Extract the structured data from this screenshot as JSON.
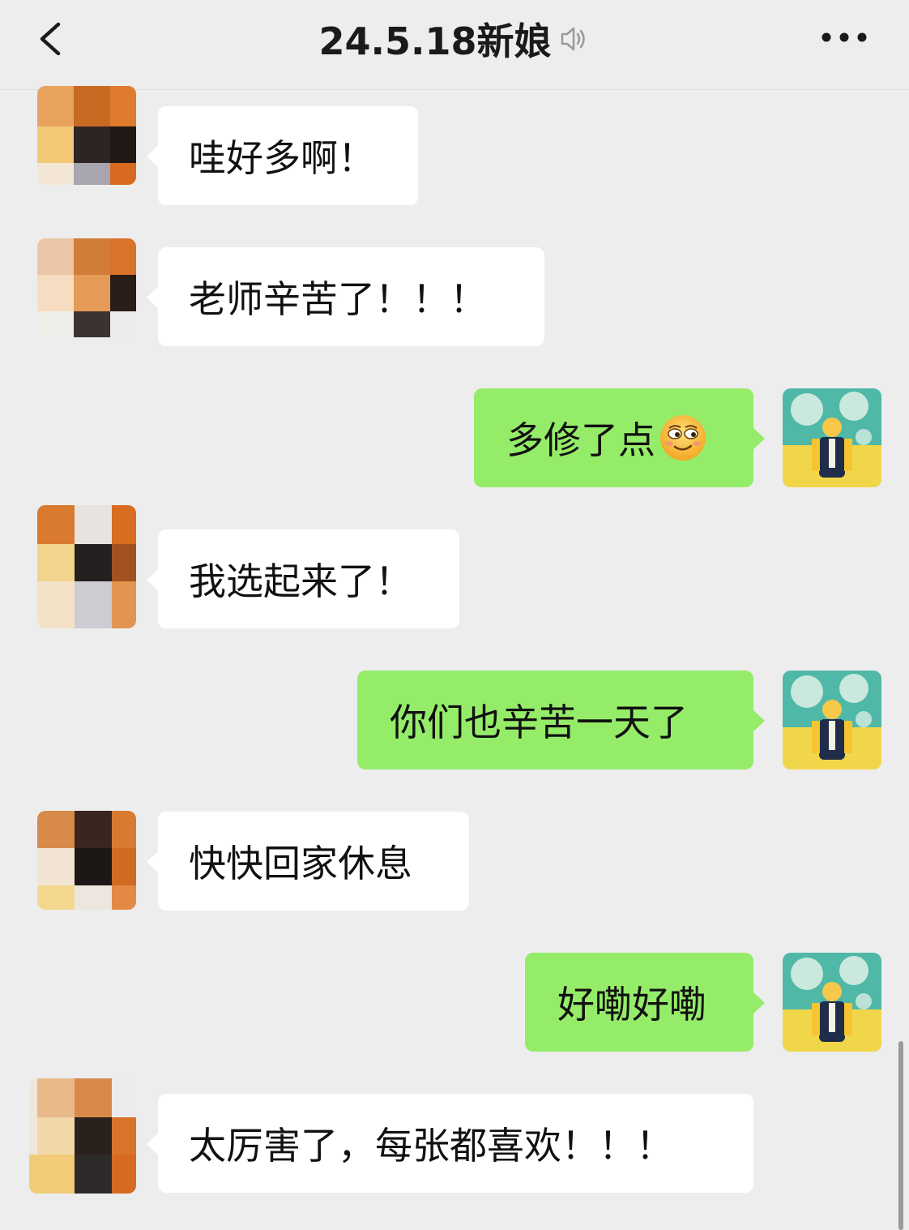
{
  "header": {
    "title": "24.5.18新娘",
    "back_icon": "chevron-left-icon",
    "mute_icon": "muted-speaker-icon",
    "more_icon": "more-dots-icon"
  },
  "colors": {
    "background": "#ededed",
    "incoming_bubble": "#ffffff",
    "outgoing_bubble": "#95ec69"
  },
  "messages": [
    {
      "side": "left",
      "text": "哇好多啊！"
    },
    {
      "side": "left",
      "text": "老师辛苦了！！！"
    },
    {
      "side": "right",
      "text": "多修了点",
      "emoji": "smirk-emoji"
    },
    {
      "side": "left",
      "text": "我选起来了！"
    },
    {
      "side": "right",
      "text": "你们也辛苦一天了"
    },
    {
      "side": "left",
      "text": "快快回家休息"
    },
    {
      "side": "right",
      "text": "好嘞好嘞"
    },
    {
      "side": "left",
      "text": "太厉害了，每张都喜欢！！！"
    }
  ]
}
